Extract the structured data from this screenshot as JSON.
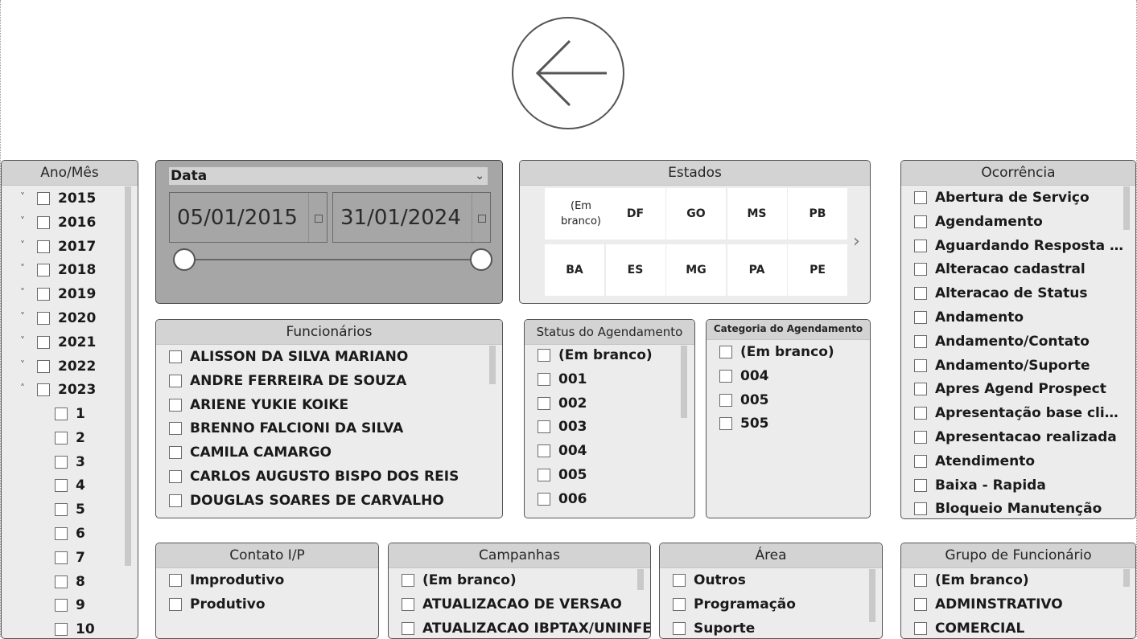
{
  "ano_mes": {
    "title": "Ano/Mês",
    "years": [
      "2015",
      "2016",
      "2017",
      "2018",
      "2019",
      "2020",
      "2021",
      "2022",
      "2023"
    ],
    "months": [
      "1",
      "2",
      "3",
      "4",
      "5",
      "6",
      "7",
      "8",
      "9",
      "10"
    ]
  },
  "data_slicer": {
    "title": "Data",
    "start_date": "05/01/2015",
    "end_date": "31/01/2024"
  },
  "estados": {
    "title": "Estados",
    "row1": [
      "(Em branco)",
      "DF",
      "GO",
      "MS",
      "PB"
    ],
    "row2": [
      "BA",
      "ES",
      "MG",
      "PA",
      "PE"
    ]
  },
  "ocorrencia": {
    "title": "Ocorrência",
    "items": [
      "Abertura de Serviço",
      "Agendamento",
      "Aguardando Resposta Clie...",
      "Alteracao cadastral",
      "Alteracao de Status",
      "Andamento",
      "Andamento/Contato",
      "Andamento/Suporte",
      "Apres Agend Prospect",
      "Apresentação base cliente",
      "Apresentacao realizada",
      "Atendimento",
      "Baixa - Rapida",
      "Bloqueio Manutenção"
    ]
  },
  "funcionarios": {
    "title": "Funcionários",
    "items": [
      "ALISSON DA SILVA MARIANO",
      "ANDRE FERREIRA DE SOUZA",
      "ARIENE YUKIE KOIKE",
      "BRENNO FALCIONI DA SILVA",
      "CAMILA CAMARGO",
      "CARLOS AUGUSTO BISPO DOS REIS",
      "DOUGLAS SOARES DE CARVALHO"
    ]
  },
  "status_agendamento": {
    "title": "Status do Agendamento",
    "items": [
      "(Em branco)",
      "001",
      "002",
      "003",
      "004",
      "005",
      "006"
    ]
  },
  "categoria_agendamento": {
    "title": "Categoria do Agendamento",
    "items": [
      "(Em branco)",
      "004",
      "005",
      "505"
    ]
  },
  "contato": {
    "title": "Contato I/P",
    "items": [
      "Improdutivo",
      "Produtivo"
    ]
  },
  "campanhas": {
    "title": "Campanhas",
    "items": [
      "(Em branco)",
      "ATUALIZACAO DE VERSAO",
      "ATUALIZACAO IBPTAX/UNINFE"
    ]
  },
  "area": {
    "title": "Área",
    "items": [
      "Outros",
      "Programação",
      "Suporte"
    ]
  },
  "grupo": {
    "title": "Grupo de Funcionário",
    "items": [
      "(Em branco)",
      "ADMINSTRATIVO",
      "COMERCIAL"
    ]
  }
}
